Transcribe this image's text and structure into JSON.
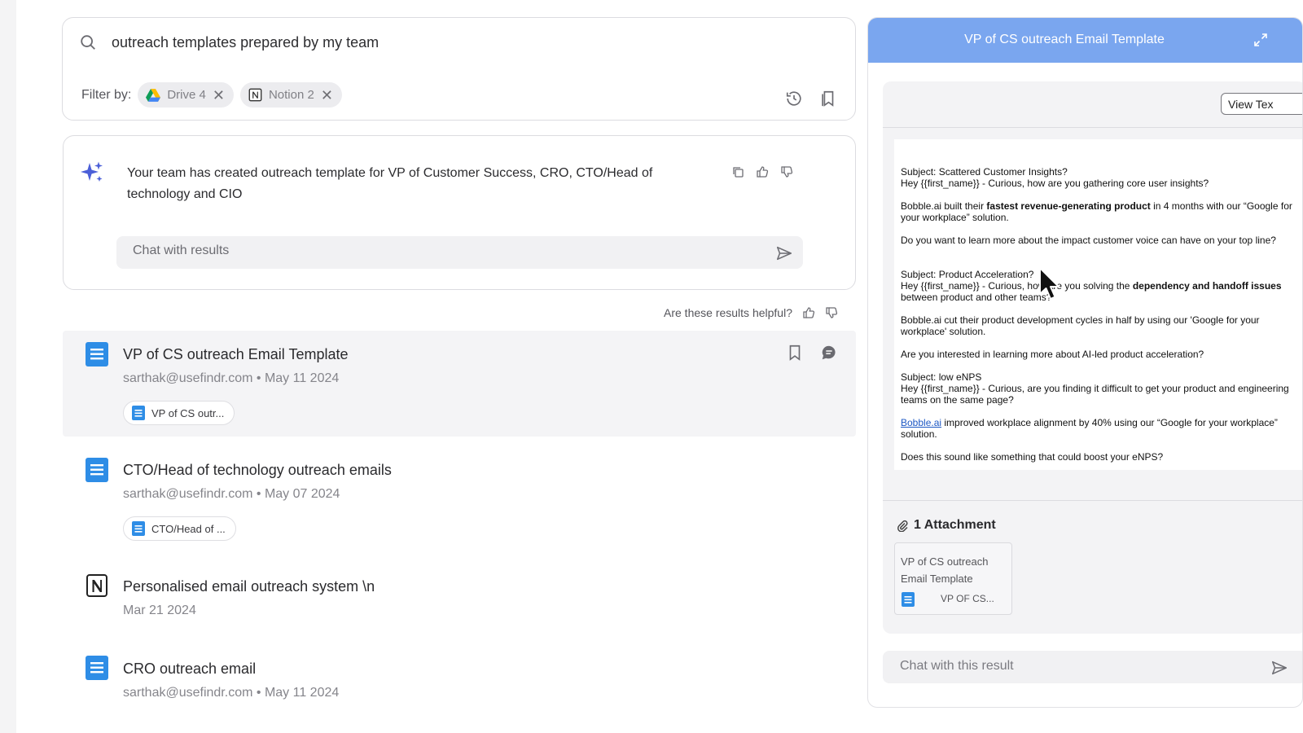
{
  "search": {
    "query": "outreach templates prepared by my team",
    "filter_label": "Filter by:",
    "filters": [
      {
        "label": "Drive 4",
        "icon": "google-drive-icon"
      },
      {
        "label": "Notion 2",
        "icon": "notion-icon"
      }
    ]
  },
  "answer": {
    "text": "Your team has created outreach template for VP of Customer Success, CRO, CTO/Head of technology and CIO",
    "chat_placeholder": "Chat with results"
  },
  "feedback": {
    "label": "Are these results helpful?"
  },
  "results": [
    {
      "title": "VP of CS outreach Email Template",
      "author": "sarthak@usefindr.com",
      "date": "May 11 2024",
      "chip": "VP of CS outr...",
      "icon": "google-doc-icon"
    },
    {
      "title": "CTO/Head of technology outreach emails",
      "author": "sarthak@usefindr.com",
      "date": "May 07 2024",
      "chip": "CTO/Head of ...",
      "icon": "google-doc-icon"
    },
    {
      "title": "Personalised email outreach system \\n",
      "date": "Mar 21 2024",
      "icon": "notion-icon"
    },
    {
      "title": "CRO outreach email",
      "author": "sarthak@usefindr.com",
      "date": "May 11 2024",
      "icon": "google-doc-icon"
    }
  ],
  "separator": "•",
  "panel": {
    "title": "VP of CS outreach Email Template",
    "view_text_button": "View Tex",
    "doc": {
      "s1_subject": "Subject: Scattered Customer Insights?",
      "s1_greeting": "Hey {{first_name}} - Curious, how are you gathering core user insights?",
      "s1_p2_pre": "Bobble.ai built their ",
      "s1_p2_bold": "fastest revenue-generating product",
      "s1_p2_post": " in 4 months with our “Google for your workplace” solution.",
      "s1_p3": "Do you want to learn more about the impact customer voice can have on your top line?",
      "s2_subject": "Subject: Product Acceleration?",
      "s2_greeting_pre": "Hey {{first_name}} - Curious, how are you solving the ",
      "s2_greeting_bold": "dependency and handoff issues",
      "s2_greeting_post": " between product and other teams?",
      "s2_p2": "Bobble.ai cut their product development cycles in half by using our 'Google for your workplace' solution.",
      "s2_p3": "Are you interested in learning more about AI-led product acceleration?",
      "s3_subject": "Subject: low eNPS",
      "s3_greeting": "Hey {{first_name}} - Curious, are you finding it difficult to get your product and engineering teams on the same page?",
      "s3_link": "Bobble.ai",
      "s3_p2_post": " improved workplace alignment by 40% using our “Google for your workplace” solution.",
      "s3_p3": "Does this sound like something that could boost your eNPS?"
    },
    "attachments_label": "1 Attachment",
    "attachment": {
      "name": "VP of CS outreach Email Template",
      "file": "VP OF CS..."
    },
    "chat_placeholder": "Chat with this result"
  }
}
